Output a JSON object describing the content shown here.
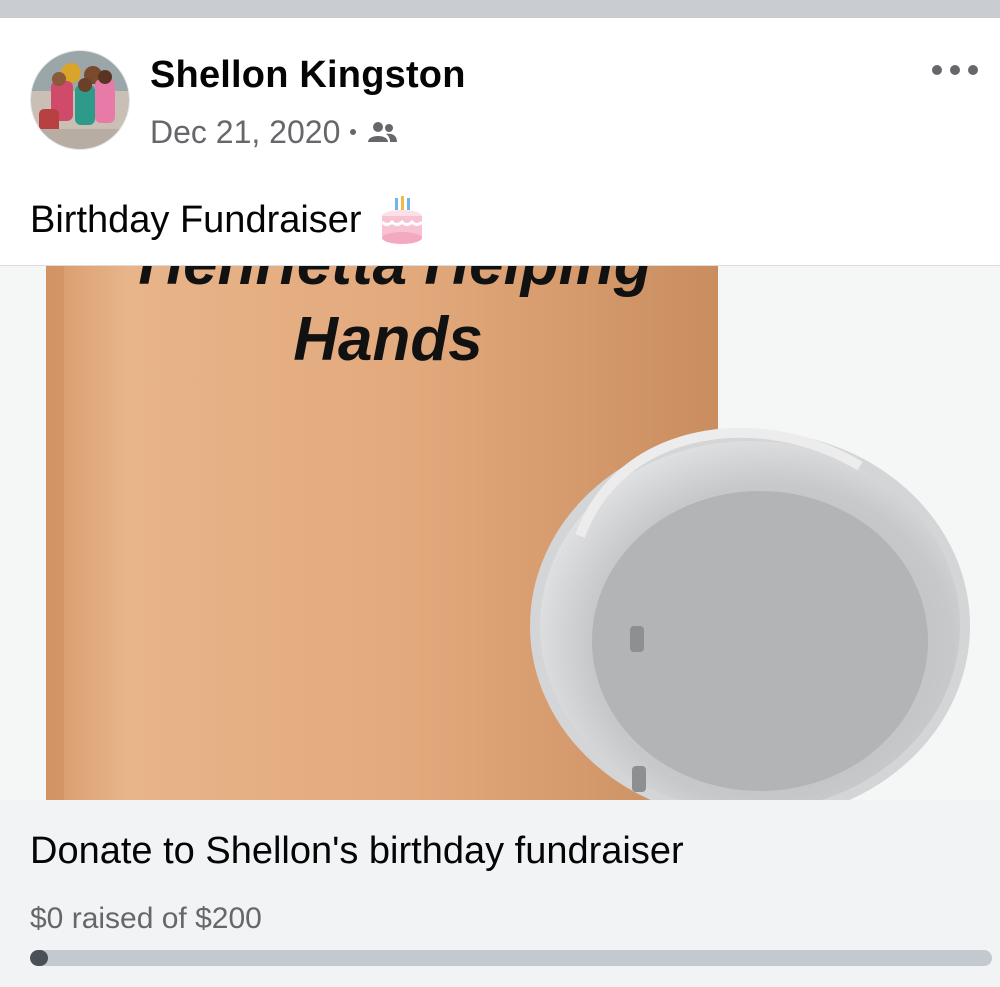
{
  "post": {
    "author_name": "Shellon Kingston",
    "date": "Dec 21, 2020",
    "audience_icon": "friends-icon",
    "more_icon": "more-options-icon",
    "text": "Birthday Fundraiser",
    "text_emoji": "birthday-cake-icon"
  },
  "image": {
    "caption_line1": "Henrietta Helping",
    "caption_line2": "Hands"
  },
  "fundraiser": {
    "title": "Donate to Shellon's birthday fundraiser",
    "progress_text": "$0 raised of $200",
    "raised": 0,
    "goal": 200
  },
  "colors": {
    "text_primary": "#050505",
    "text_secondary": "#65676b",
    "card_background": "#f2f3f5",
    "progress_track": "#c4c8cf"
  }
}
